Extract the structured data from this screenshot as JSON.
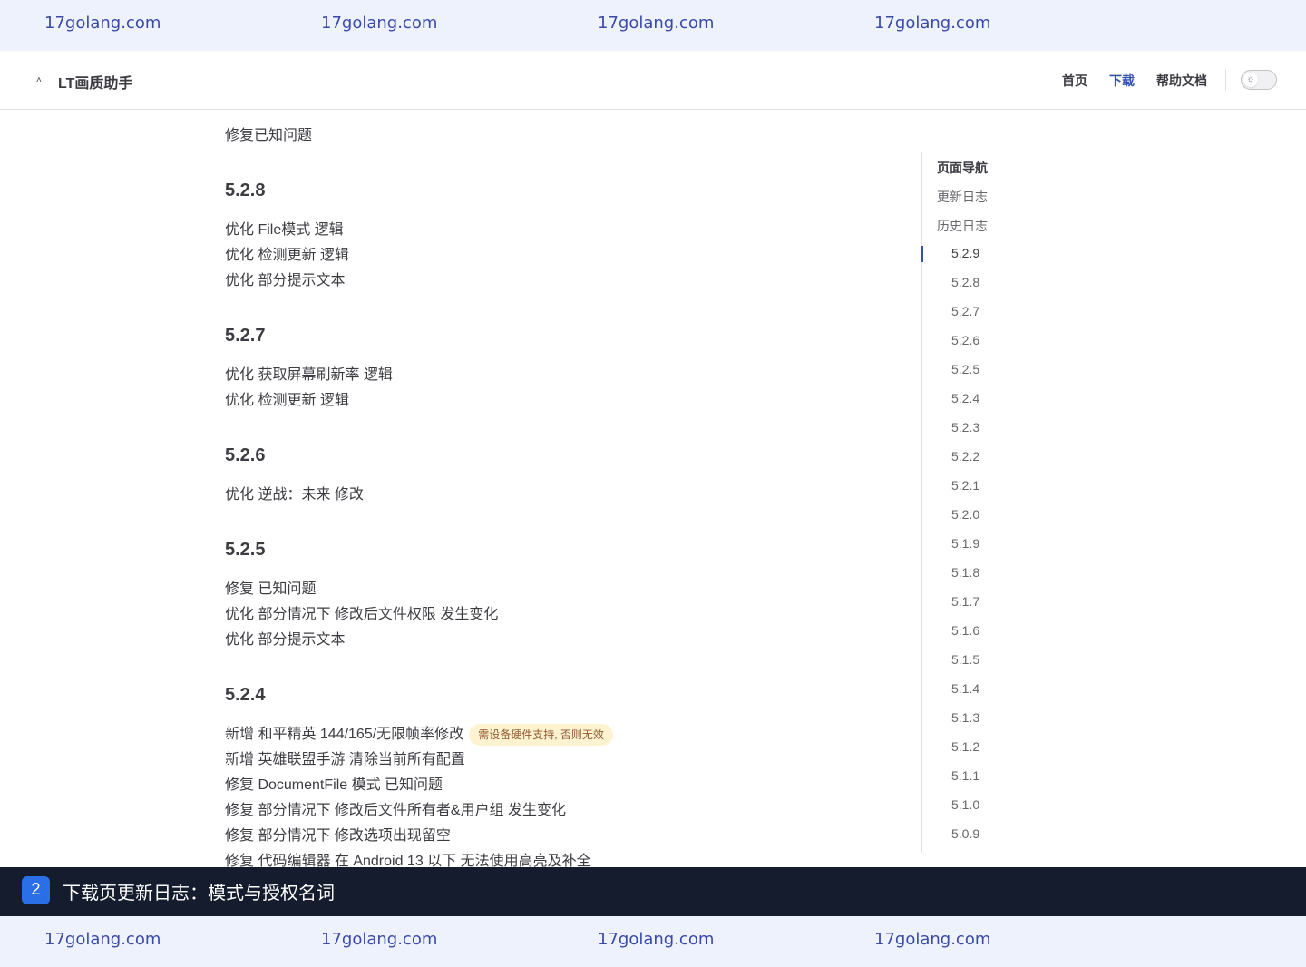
{
  "watermark": {
    "text": "17golang.com"
  },
  "navbar": {
    "title": "LT画质助手",
    "logo_glyph": "˄",
    "links": [
      "首页",
      "下载",
      "帮助文档"
    ],
    "active_link": "下载"
  },
  "content": {
    "intro_line": "修复已知问题",
    "sections": [
      {
        "version": "5.2.8",
        "items": [
          "优化 File模式 逻辑",
          "优化 检测更新 逻辑",
          "优化 部分提示文本"
        ]
      },
      {
        "version": "5.2.7",
        "items": [
          "优化 获取屏幕刷新率 逻辑",
          "优化 检测更新 逻辑"
        ]
      },
      {
        "version": "5.2.6",
        "items": [
          "优化 逆战：未来 修改"
        ]
      },
      {
        "version": "5.2.5",
        "items": [
          "修复 已知问题",
          "优化 部分情况下 修改后文件权限 发生变化",
          "优化 部分提示文本"
        ]
      },
      {
        "version": "5.2.4",
        "items": [
          "新增 和平精英 144/165/无限帧率修改",
          "新增 英雄联盟手游 清除当前所有配置",
          "修复 DocumentFile 模式 已知问题",
          "修复 部分情况下 修改后文件所有者&用户组 发生变化",
          "修复 部分情况下 修改选项出现留空",
          "修复 代码编辑器 在 Android 13 以下 无法使用高亮及补全"
        ],
        "badge": "需设备硬件支持, 否则无效"
      }
    ]
  },
  "aside": {
    "title": "页面导航",
    "top_links": [
      "更新日志",
      "历史日志"
    ],
    "versions": [
      "5.2.9",
      "5.2.8",
      "5.2.7",
      "5.2.6",
      "5.2.5",
      "5.2.4",
      "5.2.3",
      "5.2.2",
      "5.2.1",
      "5.2.0",
      "5.1.9",
      "5.1.8",
      "5.1.7",
      "5.1.6",
      "5.1.5",
      "5.1.4",
      "5.1.3",
      "5.1.2",
      "5.1.1",
      "5.1.0",
      "5.0.9"
    ],
    "active_version": "5.2.9"
  },
  "caption": {
    "number": "2",
    "text": "下载页更新日志：模式与授权名词"
  },
  "colors": {
    "accent": "#3451b2",
    "badge_bg": "#fdf3d1",
    "badge_text": "#915930",
    "caption_bg": "#151c2d"
  }
}
